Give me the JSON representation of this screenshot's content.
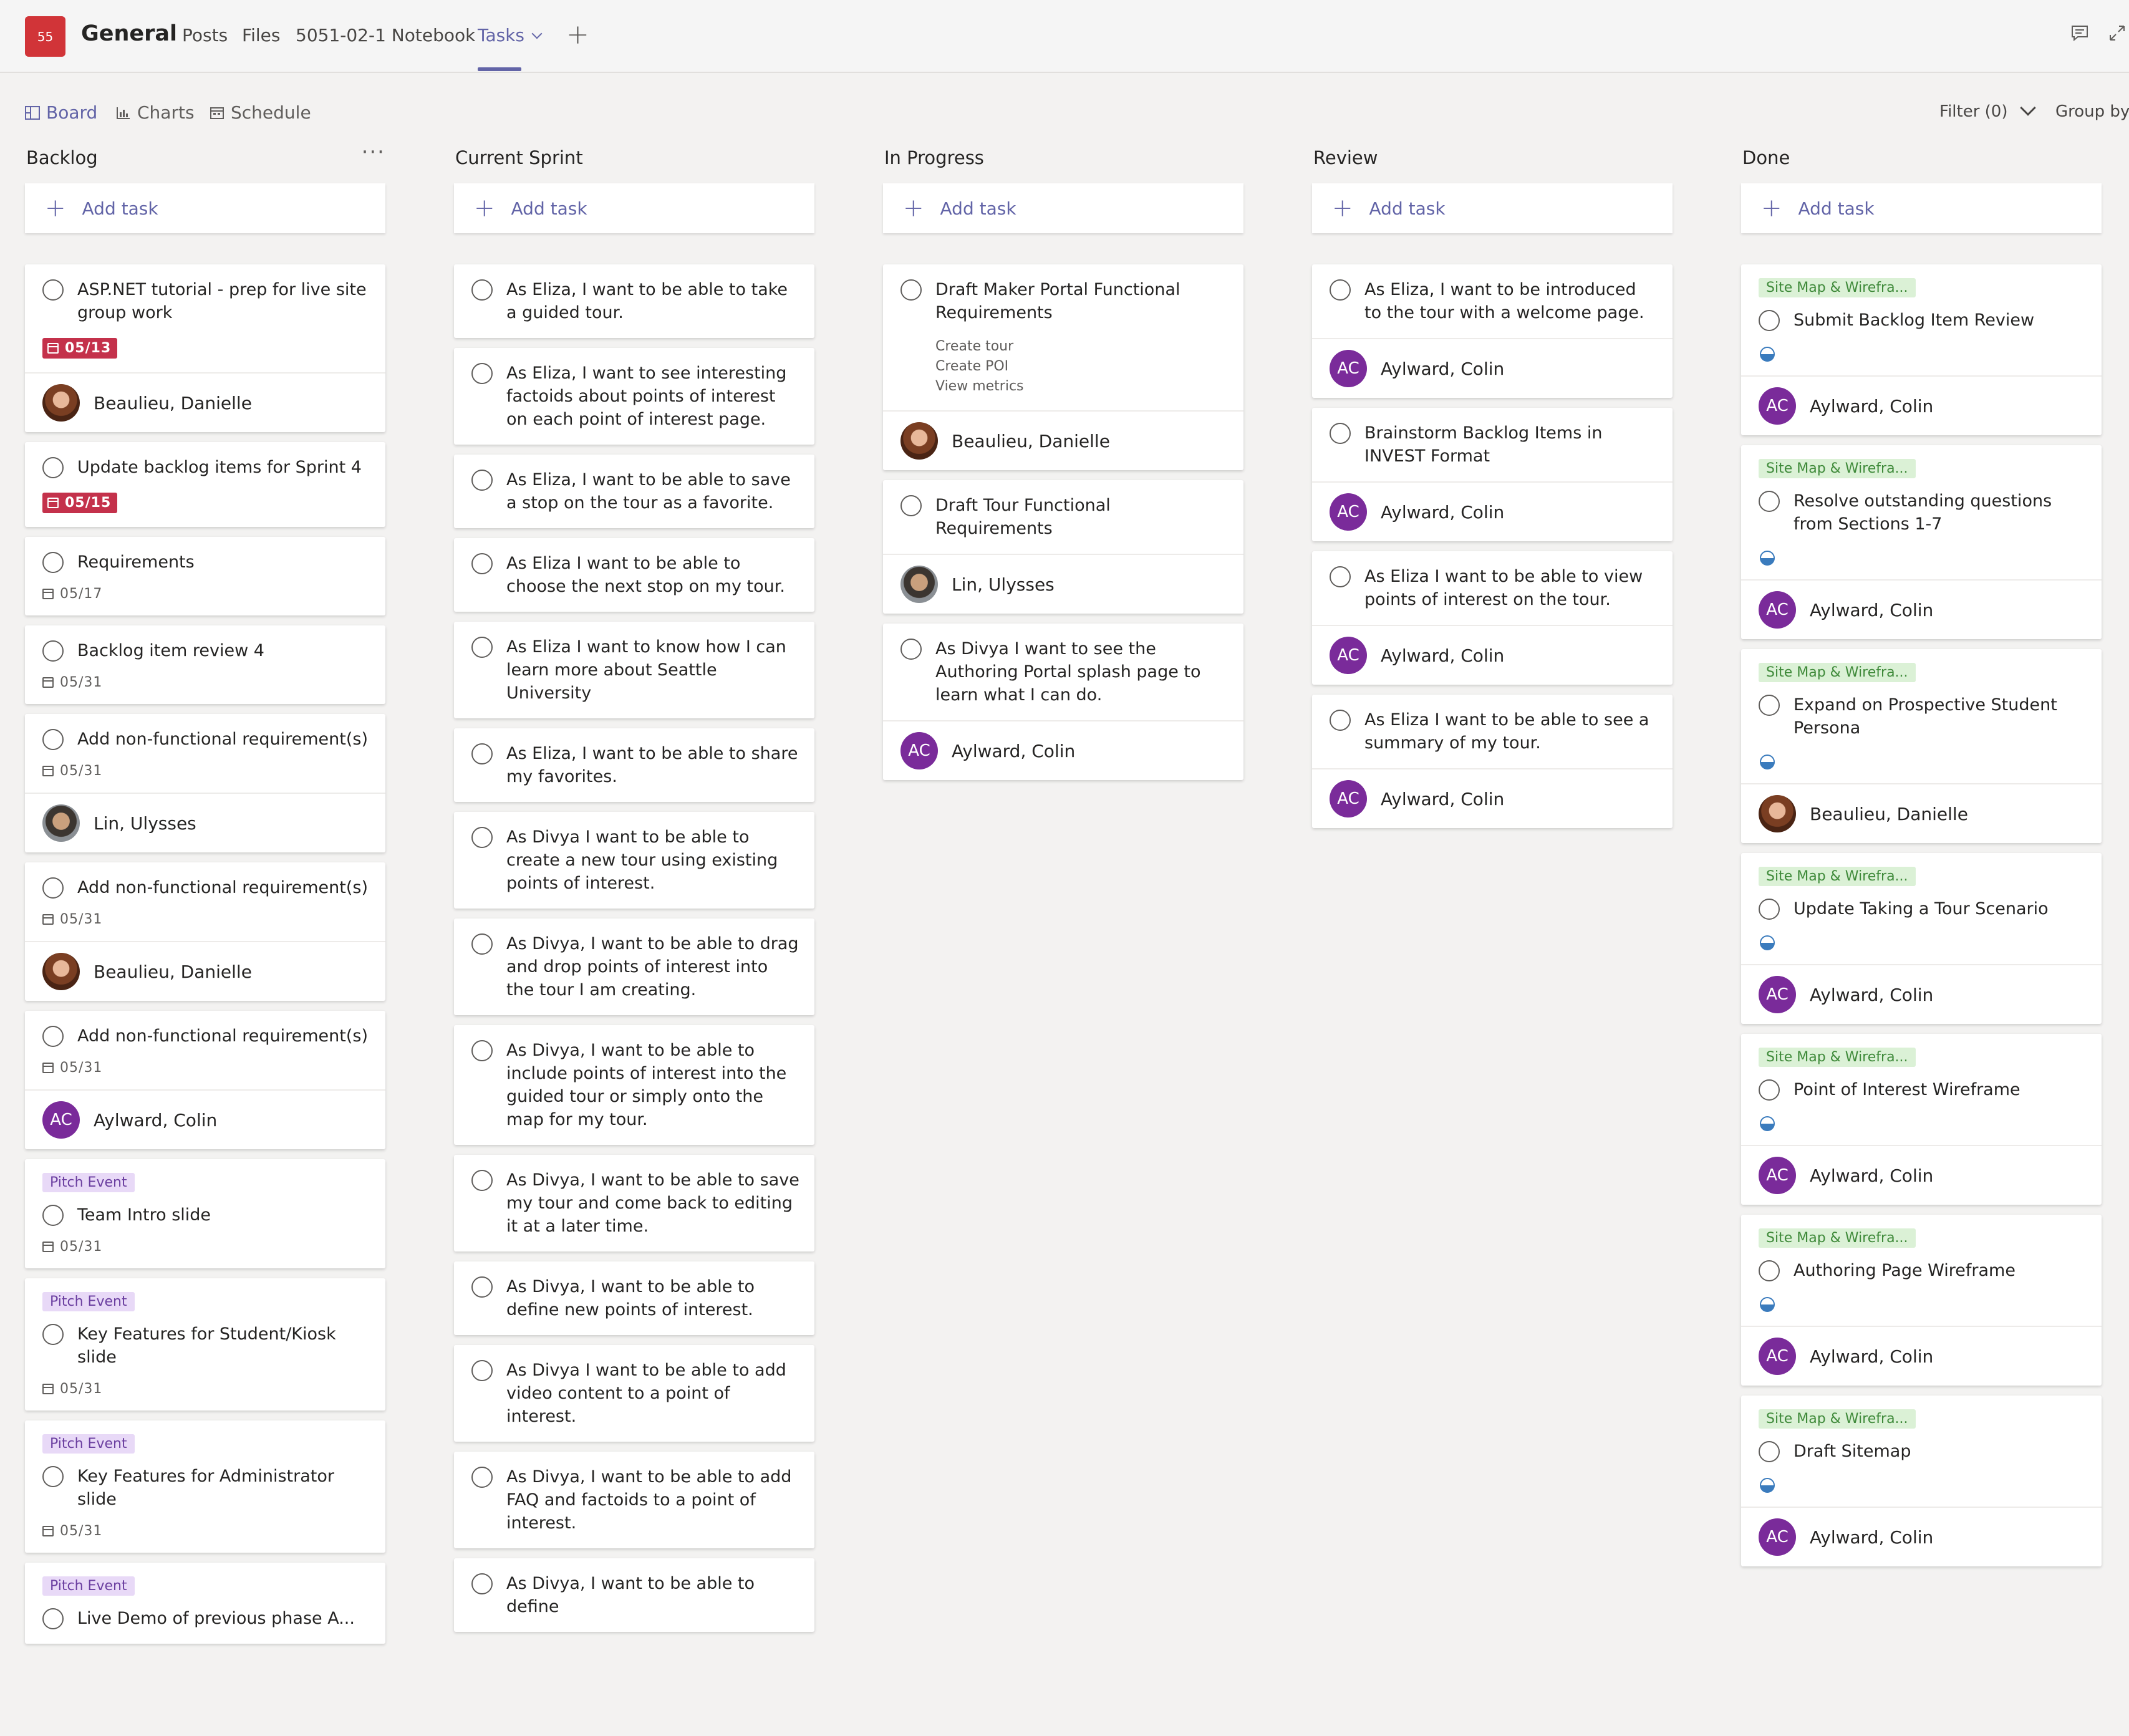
{
  "header": {
    "team_badge": "55",
    "channel": "General",
    "tabs": [
      {
        "label": "Posts"
      },
      {
        "label": "Files"
      },
      {
        "label": "5051-02-1 Notebook"
      },
      {
        "label": "Tasks"
      }
    ],
    "add_tab_symbol": "+"
  },
  "toolbar": {
    "views": [
      {
        "label": "Board",
        "icon": "board-icon"
      },
      {
        "label": "Charts",
        "icon": "charts-icon"
      },
      {
        "label": "Schedule",
        "icon": "schedule-icon"
      }
    ],
    "filter_label": "Filter (0)",
    "group_by_label": "Group by"
  },
  "board": {
    "add_task_label": "Add task",
    "more_symbol": "···",
    "columns": [
      {
        "title": "Backlog",
        "cards": [
          {
            "title": "ASP.NET tutorial - prep for live site group work",
            "date": "05/13",
            "date_style": "overdue",
            "assignee": "Beaulieu, Danielle",
            "avatar": "db"
          },
          {
            "title": "Update backlog items for Sprint 4",
            "date": "05/15",
            "date_style": "overdue"
          },
          {
            "title": "Requirements",
            "date": "05/17"
          },
          {
            "title": "Backlog item review 4",
            "date": "05/31"
          },
          {
            "title": "Add non-functional requirement(s)",
            "date": "05/31",
            "assignee": "Lin, Ulysses",
            "avatar": "lu"
          },
          {
            "title": "Add non-functional requirement(s)",
            "date": "05/31",
            "assignee": "Beaulieu, Danielle",
            "avatar": "db"
          },
          {
            "title": "Add non-functional requirement(s)",
            "date": "05/31",
            "assignee": "Aylward, Colin",
            "avatar": "ac",
            "initials": "AC"
          },
          {
            "label": "Pitch Event",
            "label_style": "pitch",
            "title": "Team Intro slide",
            "date": "05/31"
          },
          {
            "label": "Pitch Event",
            "label_style": "pitch",
            "title": "Key Features for Student/Kiosk slide",
            "date": "05/31"
          },
          {
            "label": "Pitch Event",
            "label_style": "pitch",
            "title": "Key Features for Administrator slide",
            "date": "05/31"
          },
          {
            "label": "Pitch Event",
            "label_style": "pitch",
            "title": "Live Demo of previous phase A..."
          }
        ]
      },
      {
        "title": "Current Sprint",
        "cards": [
          {
            "title": "As Eliza, I want to be able to take a guided tour."
          },
          {
            "title": "As Eliza, I want to see interesting factoids about points of interest on each point of interest page."
          },
          {
            "title": "As Eliza, I want to be able to save a stop on the tour as a favorite."
          },
          {
            "title": "As Eliza I want to be able to choose the next stop on my tour."
          },
          {
            "title": "As Eliza I want to know how I can learn more about Seattle University"
          },
          {
            "title": "As Eliza, I want to be able to share my favorites."
          },
          {
            "title": "As Divya I want to be able to create a new tour using existing points of interest."
          },
          {
            "title": "As Divya, I want to be able to drag and drop points of interest into the tour I am creating."
          },
          {
            "title": "As Divya, I want to be able to include points of interest into the guided tour or simply onto the map for my tour."
          },
          {
            "title": "As Divya, I want to be able to save my tour and come back to editing it at a later time."
          },
          {
            "title": "As Divya, I want to be able to define new points of interest."
          },
          {
            "title": "As Divya I want to be able to add video content to a point of interest."
          },
          {
            "title": "As Divya, I want to be able to add FAQ and factoids to a point of interest."
          },
          {
            "title": "As Divya, I want to be able to define"
          }
        ]
      },
      {
        "title": "In Progress",
        "cards": [
          {
            "title": "Draft Maker Portal Functional Requirements",
            "checklist": [
              "Create tour",
              "Create POI",
              "View metrics"
            ],
            "assignee": "Beaulieu, Danielle",
            "avatar": "db"
          },
          {
            "title": "Draft Tour Functional Requirements",
            "assignee": "Lin, Ulysses",
            "avatar": "lu"
          },
          {
            "title": "As Divya I want to see the Authoring Portal splash page to learn what I can do.",
            "assignee": "Aylward, Colin",
            "avatar": "ac",
            "initials": "AC"
          }
        ]
      },
      {
        "title": "Review",
        "cards": [
          {
            "title": "As Eliza, I want to be introduced to the tour with a welcome page.",
            "assignee": "Aylward, Colin",
            "avatar": "ac",
            "initials": "AC"
          },
          {
            "title": "Brainstorm Backlog Items in INVEST Format",
            "assignee": "Aylward, Colin",
            "avatar": "ac",
            "initials": "AC"
          },
          {
            "title": "As Eliza I want to be able to view points of interest on the tour.",
            "assignee": "Aylward, Colin",
            "avatar": "ac",
            "initials": "AC"
          },
          {
            "title": "As Eliza I want to be able to see a summary of my tour.",
            "assignee": "Aylward, Colin",
            "avatar": "ac",
            "initials": "AC"
          }
        ]
      },
      {
        "title": "Done",
        "cards": [
          {
            "label": "Site Map & Wirefra...",
            "label_style": "site",
            "title": "Submit Backlog Item Review",
            "progress": "half",
            "assignee": "Aylward, Colin",
            "avatar": "ac",
            "initials": "AC"
          },
          {
            "label": "Site Map & Wirefra...",
            "label_style": "site",
            "title": "Resolve outstanding questions from Sections 1-7",
            "progress": "half",
            "assignee": "Aylward, Colin",
            "avatar": "ac",
            "initials": "AC"
          },
          {
            "label": "Site Map & Wirefra...",
            "label_style": "site",
            "title": "Expand on Prospective Student Persona",
            "progress": "half",
            "assignee": "Beaulieu, Danielle",
            "avatar": "db"
          },
          {
            "label": "Site Map & Wirefra...",
            "label_style": "site",
            "title": "Update Taking a Tour Scenario",
            "progress": "half",
            "assignee": "Aylward, Colin",
            "avatar": "ac",
            "initials": "AC"
          },
          {
            "label": "Site Map & Wirefra...",
            "label_style": "site",
            "title": "Point of Interest Wireframe",
            "progress": "half",
            "assignee": "Aylward, Colin",
            "avatar": "ac",
            "initials": "AC"
          },
          {
            "label": "Site Map & Wirefra...",
            "label_style": "site",
            "title": "Authoring Page Wireframe",
            "progress": "half",
            "assignee": "Aylward, Colin",
            "avatar": "ac",
            "initials": "AC"
          },
          {
            "label": "Site Map & Wirefra...",
            "label_style": "site",
            "title": "Draft Sitemap",
            "progress": "half",
            "assignee": "Aylward, Colin",
            "avatar": "ac",
            "initials": "AC"
          }
        ]
      }
    ]
  }
}
